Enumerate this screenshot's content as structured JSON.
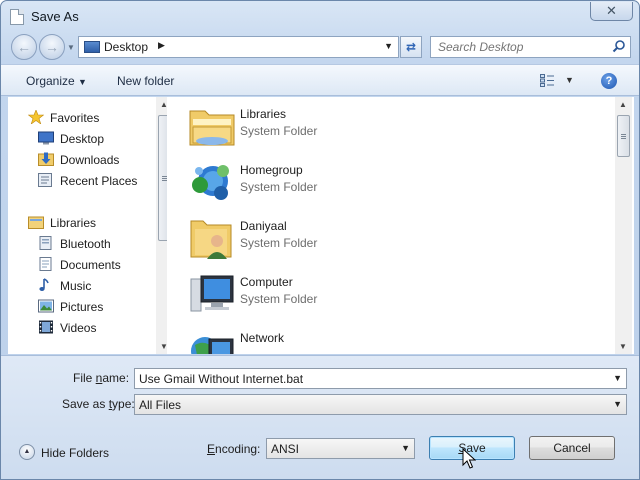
{
  "window": {
    "title": "Save As",
    "close_symbol": "✕"
  },
  "address": {
    "location": "Desktop",
    "search_placeholder": "Search Desktop"
  },
  "toolbar": {
    "organize_label": "Organize",
    "new_folder_label": "New folder"
  },
  "sidebar": {
    "items": [
      {
        "label": "Favorites",
        "icon": "star-icon"
      },
      {
        "label": "Desktop",
        "icon": "desktop-icon"
      },
      {
        "label": "Downloads",
        "icon": "downloads-icon"
      },
      {
        "label": "Recent Places",
        "icon": "recent-places-icon"
      },
      {
        "label": "Libraries",
        "icon": "libraries-icon"
      },
      {
        "label": "Bluetooth",
        "icon": "bluetooth-folder-icon"
      },
      {
        "label": "Documents",
        "icon": "documents-icon"
      },
      {
        "label": "Music",
        "icon": "music-icon"
      },
      {
        "label": "Pictures",
        "icon": "pictures-icon"
      },
      {
        "label": "Videos",
        "icon": "videos-icon"
      }
    ]
  },
  "files": [
    {
      "name": "Libraries",
      "type": "System Folder",
      "icon": "libraries-folder-icon"
    },
    {
      "name": "Homegroup",
      "type": "System Folder",
      "icon": "homegroup-icon"
    },
    {
      "name": "Daniyaal",
      "type": "System Folder",
      "icon": "user-folder-icon"
    },
    {
      "name": "Computer",
      "type": "System Folder",
      "icon": "computer-icon"
    },
    {
      "name": "Network",
      "type": "",
      "icon": "network-icon"
    }
  ],
  "form": {
    "file_name_label_pre": "File ",
    "file_name_label_key": "n",
    "file_name_label_post": "ame:",
    "file_name_value": "Use Gmail Without Internet.bat",
    "save_type_label_pre": "Save as ",
    "save_type_label_key": "t",
    "save_type_label_post": "ype:",
    "save_type_value": "All Files",
    "encoding_label_key": "E",
    "encoding_label_post": "ncoding:",
    "encoding_value": "ANSI",
    "hide_folders_label": "Hide Folders",
    "save_label_key": "S",
    "save_label_post": "ave",
    "cancel_label": "Cancel"
  }
}
